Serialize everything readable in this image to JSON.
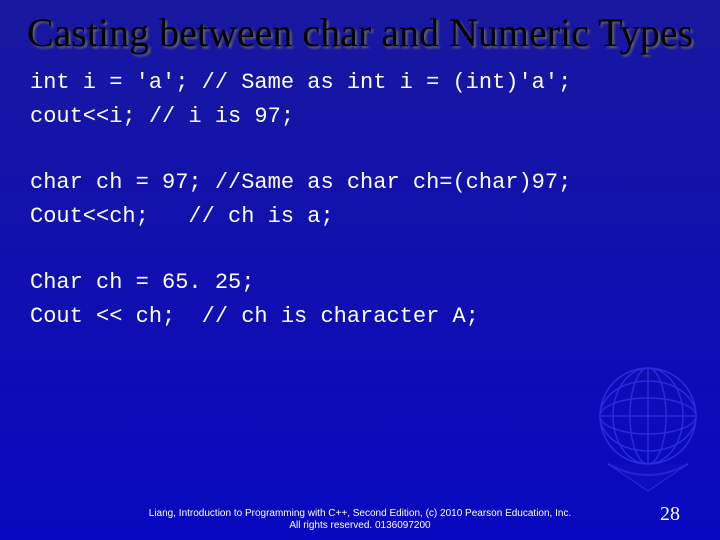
{
  "title": "Casting between char and Numeric Types",
  "code": {
    "block1": "int i = 'a'; // Same as int i = (int)'a';\ncout<<i; // i is 97;",
    "block2": "char ch = 97; //Same as char ch=(char)97;\nCout<<ch;   // ch is a;",
    "block3": "Char ch = 65. 25;\nCout << ch;  // ch is character A;"
  },
  "footer": {
    "line1": "Liang, Introduction to Programming with C++, Second Edition, (c) 2010 Pearson Education, Inc.",
    "line2": "All rights reserved. 0136097200"
  },
  "page_number": "28"
}
